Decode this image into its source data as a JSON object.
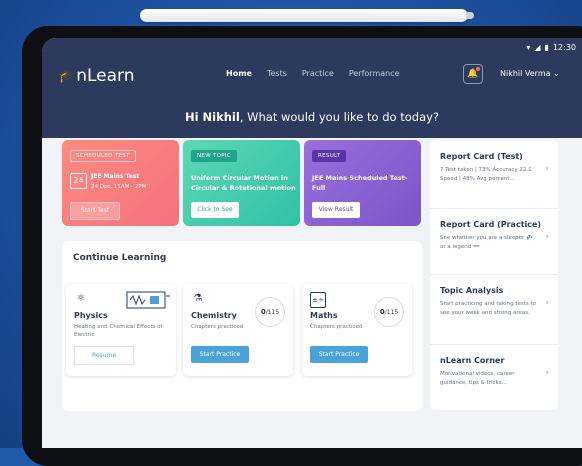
{
  "status": {
    "time": "12:30"
  },
  "app": {
    "logo": "nLearn"
  },
  "nav": {
    "items": [
      "Home",
      "Tests",
      "Practice",
      "Performance"
    ],
    "active": "Home"
  },
  "user": {
    "name": "Nikhil Verma ⌄"
  },
  "greeting": {
    "name": "Hi Nikhil",
    "text": ", What would you like to do today?"
  },
  "cards": [
    {
      "tag": "SCHEDULED TEST",
      "day": "24",
      "title": "JEE Mains Test",
      "subtitle": "24 Dec, 11AM - 2PM",
      "button": "Start Test"
    },
    {
      "tag": "NEW TOPIC",
      "title": "Uniform Circular Motion in Circular & Rotational motion",
      "button": "Click to See"
    },
    {
      "tag": "RESULT",
      "title": "JEE Mains Scheduled Test- Full",
      "button": "View Result"
    }
  ],
  "continue": {
    "title": "Continue Learning",
    "subjects": [
      {
        "name": "Physics",
        "desc": "Heating and Chemical Effects of Electric",
        "button": "Resume"
      },
      {
        "name": "Chemistry",
        "desc": "Chapters practiced",
        "count": "0",
        "total": "/115",
        "button": "Start Practice"
      },
      {
        "name": "Maths",
        "desc": "Chapters practiced",
        "count": "0",
        "total": "/115",
        "button": "Start Practice"
      }
    ]
  },
  "right": [
    {
      "title": "Report Card (Test)",
      "text": "7 Test taken | 73% Accuracy 22.1 Speed | 48% Avg percent..."
    },
    {
      "title": "Report Card (Practice)",
      "text": "See whether you are a sleeper 💤 or a legend 👓"
    },
    {
      "title": "Topic Analysis",
      "text": "Start practicing and taking tests to see your weak and strong areas."
    },
    {
      "title": "nLearn Corner",
      "text": "Motivational videos, career guidance, tips & tricks..."
    }
  ],
  "colors": {
    "header": "#2b3a5d",
    "accent": "#4aa3d8",
    "card1": "#f3727d",
    "card2": "#2fc2a4",
    "card3": "#7a55c9"
  }
}
